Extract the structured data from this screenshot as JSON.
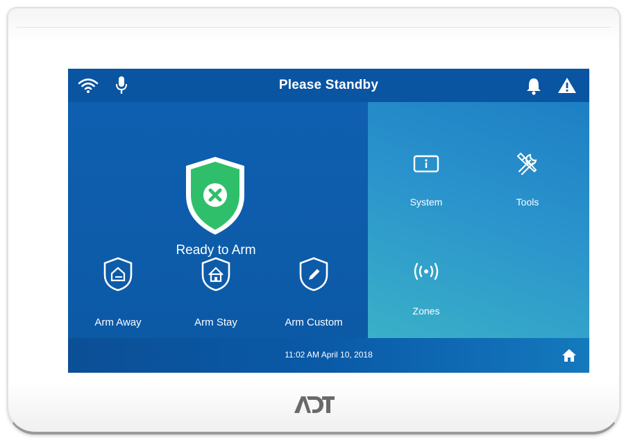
{
  "status_bar": {
    "title": "Please Standby",
    "left_icons": [
      "wifi-icon",
      "microphone-icon"
    ],
    "right_icons": [
      "bell-icon",
      "warning-icon"
    ]
  },
  "security": {
    "status_label": "Ready to Arm",
    "status_icon": "shield-x-icon",
    "status_color": "#2fbf6a"
  },
  "arm_buttons": [
    {
      "label": "Arm Away",
      "icon": "shield-house-exit-icon"
    },
    {
      "label": "Arm Stay",
      "icon": "shield-house-icon"
    },
    {
      "label": "Arm Custom",
      "icon": "shield-pencil-icon"
    }
  ],
  "tiles": [
    {
      "label": "System",
      "icon": "info-panel-icon"
    },
    {
      "label": "Tools",
      "icon": "tools-icon"
    },
    {
      "label": "Zones",
      "icon": "wireless-sensor-icon"
    }
  ],
  "bottom_bar": {
    "datetime": "11:02 AM April 10, 2018",
    "home_icon": "home-icon"
  },
  "brand": {
    "logo_text": "ADT"
  },
  "colors": {
    "screen_blue": "#0d5aa6",
    "panel_teal": "#3ab0c8",
    "ready_green": "#2fbf6a",
    "icon_white": "#ffffff"
  }
}
